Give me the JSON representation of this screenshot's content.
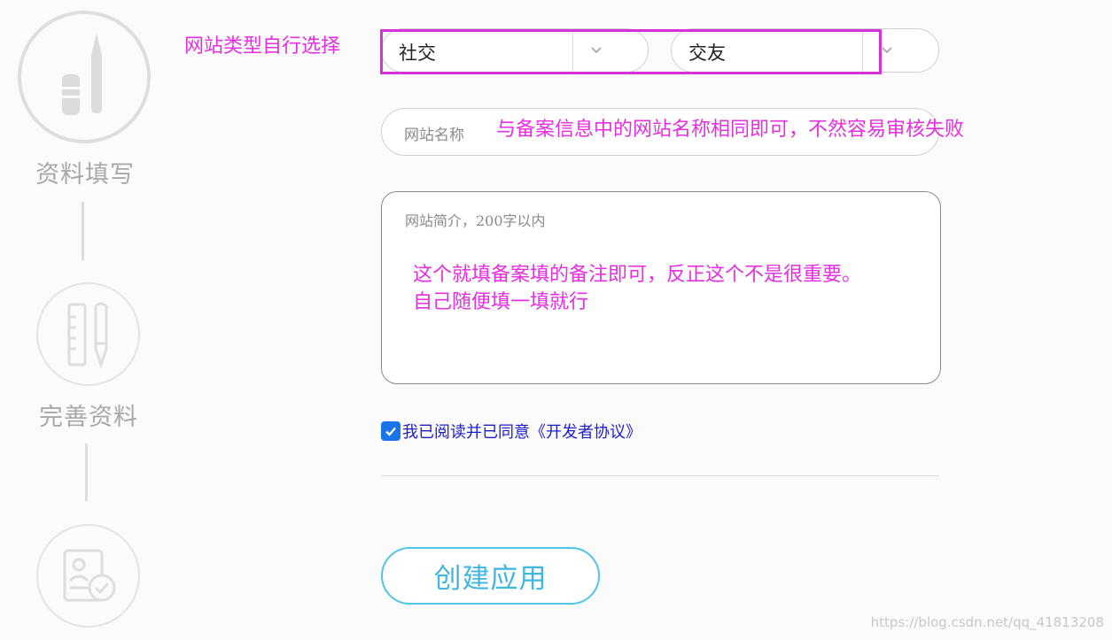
{
  "steps": [
    {
      "label": "资料填写",
      "icon": "pen-icon"
    },
    {
      "label": "完善资料",
      "icon": "ruler-pen-icon"
    },
    {
      "label": "",
      "icon": "id-card-check-icon"
    }
  ],
  "form": {
    "category_primary": "社交",
    "category_secondary": "交友",
    "site_name_placeholder": "网站名称",
    "site_desc_placeholder": "网站简介，200字以内",
    "agree_checked": true,
    "agree_text": "我已阅读并已同意《开发者协议》",
    "submit_label": "创建应用"
  },
  "annotations": {
    "type_note": "网站类型自行选择",
    "name_note": "与备案信息中的网站名称相同即可，不然容易审核失败",
    "desc_note_line1": "这个就填备案填的备注即可，反正这个不是很重要。",
    "desc_note_line2": "自己随便填一填就行"
  },
  "watermark": "https://blog.csdn.net/qq_41813208",
  "colors": {
    "annotation": "#e62fe0",
    "highlight_box": "#d630d6",
    "button_accent": "#40b6e0",
    "checkbox": "#1a73e8",
    "link_text": "#1c1ccd"
  }
}
